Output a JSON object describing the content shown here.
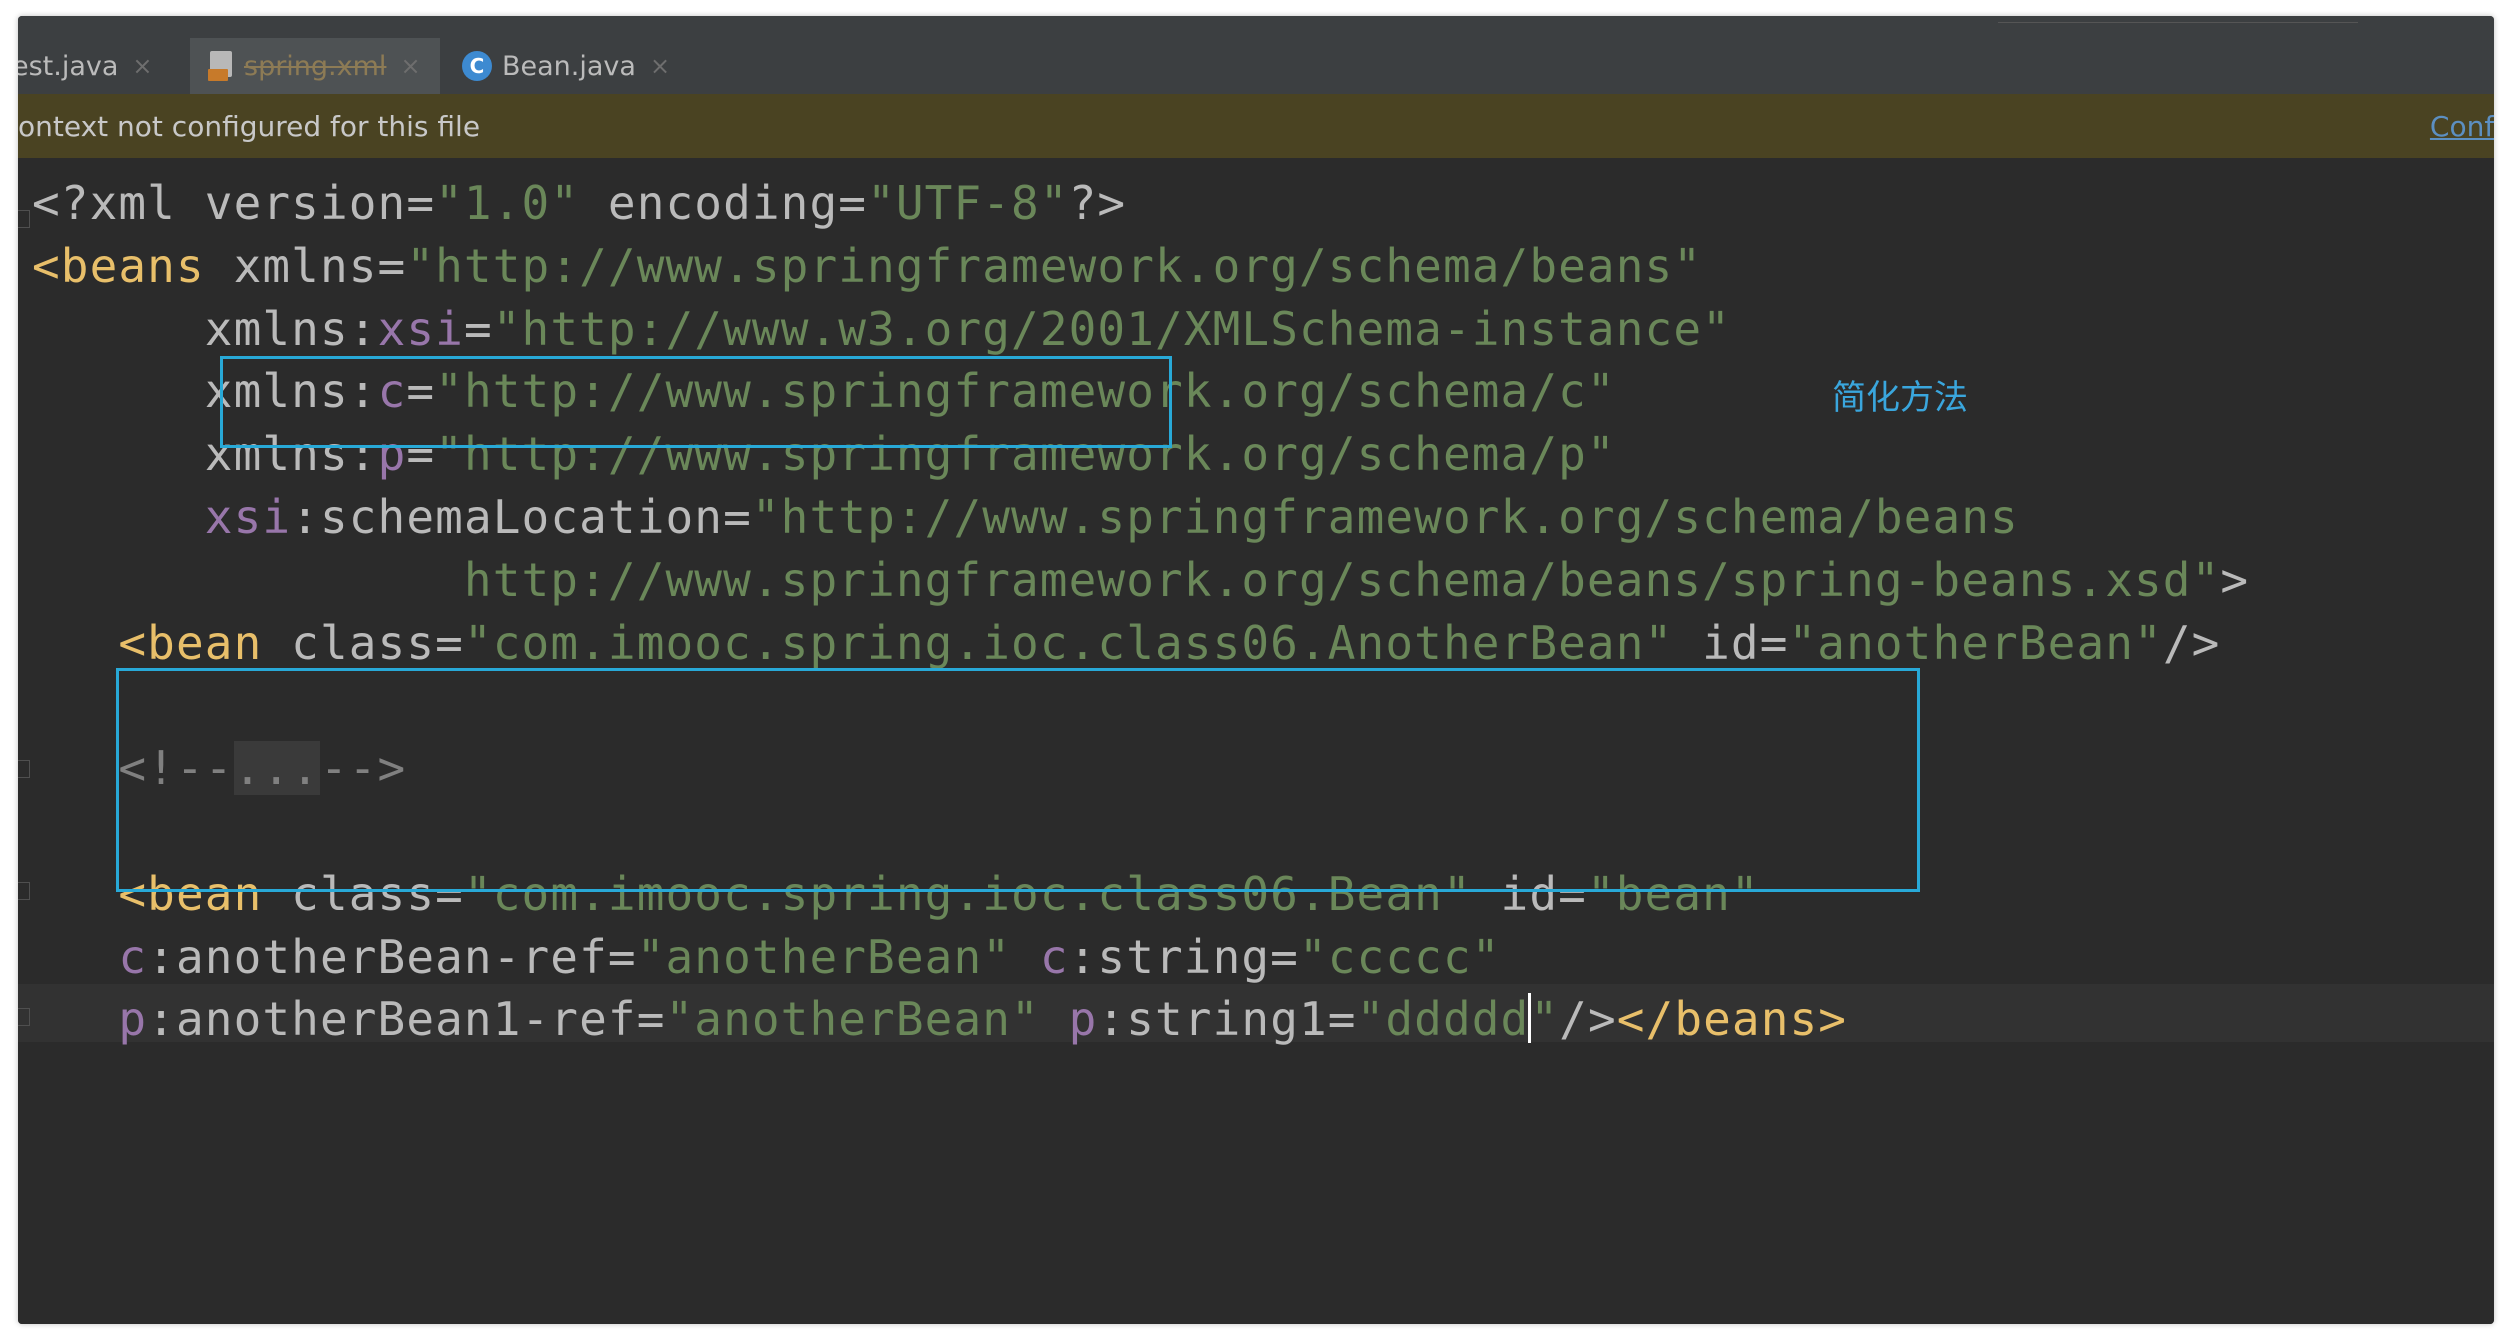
{
  "tabs": [
    {
      "label": "est.java",
      "icon": "java-class-icon"
    },
    {
      "label": "spring.xml",
      "icon": "xml-file-icon",
      "active": true
    },
    {
      "label": "Bean.java",
      "icon": "class-c-icon"
    }
  ],
  "close_glyph": "×",
  "class_icon_letter": "C",
  "notice": {
    "message": "ontext not configured for this file",
    "link": "Confi"
  },
  "annotation": "简化方法",
  "code": {
    "line1": {
      "decl": "<?xml",
      "attr1": " version=",
      "val1": "\"1.0\"",
      "attr2": " encoding=",
      "val2": "\"UTF-8\"",
      "end": "?>"
    },
    "line2": {
      "tag": "<beans",
      "attr": " xmlns=",
      "val": "\"http://www.springframework.org/schema/beans\""
    },
    "line3": {
      "indent": "      ",
      "prefix": "xmlns:",
      "ns": "xsi",
      "eq": "=",
      "val": "\"http://www.w3.org/2001/XMLSchema-instance\""
    },
    "line4": {
      "indent": "      ",
      "prefix": "xmlns:",
      "ns": "c",
      "eq": "=",
      "val": "\"http://www.springframework.org/schema/c\""
    },
    "line5": {
      "indent": "      ",
      "prefix": "xmlns:",
      "ns": "p",
      "eq": "=",
      "val": "\"http://www.springframework.org/schema/p\""
    },
    "line6": {
      "indent": "      ",
      "ns": "xsi",
      "attr": ":schemaLocation=",
      "val": "\"http://www.springframework.org/schema/beans"
    },
    "line7": {
      "indent": "               ",
      "val": "http://www.springframework.org/schema/beans/spring-beans.xsd\"",
      "end": ">"
    },
    "line8": {
      "indent": "   ",
      "tag": "<bean",
      "attr1": " class=",
      "val1": "\"com.imooc.spring.ioc.class06.AnotherBean\"",
      "attr2": " id=",
      "val2": "\"anotherBean\"",
      "end": "/>"
    },
    "line10": {
      "indent": "   ",
      "open": "<!--",
      "folded": "...",
      "close": "-->"
    },
    "line12": {
      "indent": "   ",
      "tag": "<bean",
      "attr1": " class=",
      "val1": "\"com.imooc.spring.ioc.class06.Bean\"",
      "attr2": " id=",
      "val2": "\"bean\""
    },
    "line13": {
      "indent": "   ",
      "ns1": "c",
      "attr1": ":anotherBean-ref=",
      "val1": "\"anotherBean\"",
      "sp": " ",
      "ns2": "c",
      "attr2": ":string=",
      "val2": "\"ccccc\""
    },
    "line14": {
      "indent": "   ",
      "ns1": "p",
      "attr1": ":anotherBean1-ref=",
      "val1": "\"anotherBean\"",
      "sp": " ",
      "ns2": "p",
      "attr2": ":string1=",
      "val2a": "\"ddddd",
      "val2b": "\"",
      "end": "/>"
    },
    "line18": {
      "tag": "</beans>"
    }
  },
  "colors": {
    "editor_bg": "#2b2b2b",
    "tag": "#e8bf6a",
    "attribute": "#bababa",
    "value": "#6a8759",
    "namespace": "#9876aa",
    "comment": "#808080",
    "highlight_box": "#28a9d7",
    "notice_bg": "#4a4322"
  }
}
